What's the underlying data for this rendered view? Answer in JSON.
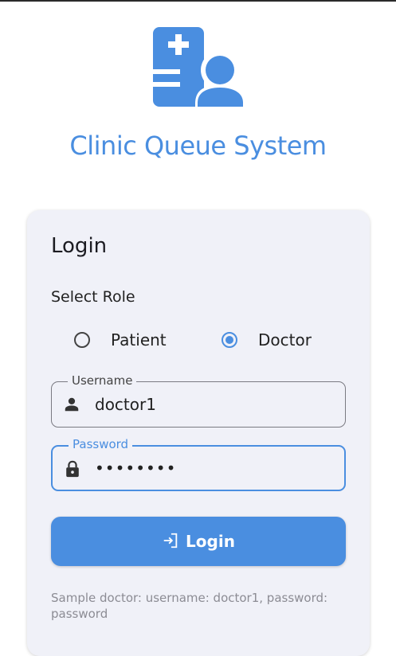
{
  "app": {
    "title": "Clinic Queue System"
  },
  "colors": {
    "accent": "#4a8ee0",
    "card_bg": "#f0f1f8"
  },
  "icons": {
    "logo": "clinic-logo-icon",
    "username": "person-icon",
    "password": "lock-icon",
    "login": "login-icon"
  },
  "login": {
    "title": "Login",
    "role_label": "Select Role",
    "roles": [
      {
        "label": "Patient",
        "selected": false
      },
      {
        "label": "Doctor",
        "selected": true
      }
    ],
    "username": {
      "label": "Username",
      "value": "doctor1"
    },
    "password": {
      "label": "Password",
      "value": "••••••••"
    },
    "button_label": "Login",
    "hint": "Sample doctor: username: doctor1, password: password"
  }
}
